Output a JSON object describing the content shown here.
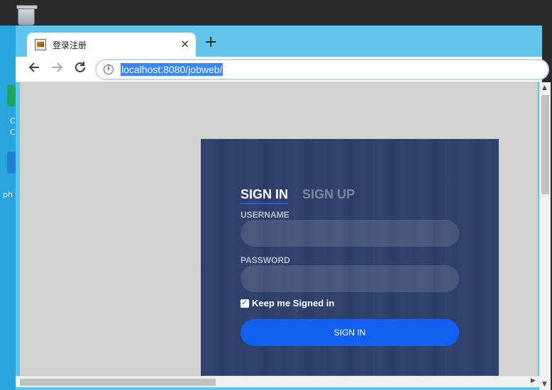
{
  "browser": {
    "tab_title": "登录注册",
    "tab_close": "×",
    "new_tab": "+",
    "url": "localhost:8080/jobweb/",
    "info_symbol": "i"
  },
  "desktop": {
    "icon_labels": [
      "C",
      "C",
      "ph"
    ]
  },
  "login": {
    "tab_signin": "SIGN IN",
    "tab_signup": "SIGN UP",
    "username_label": "USERNAME",
    "username_value": "",
    "password_label": "PASSWORD",
    "password_value": "",
    "keep_signed_in_label": "Keep me Signed in",
    "keep_signed_in_checked": true,
    "signin_button": "SIGN IN"
  },
  "colors": {
    "accent": "#1161ee",
    "card_bg": "#283866",
    "browser_frame": "#61c5ea",
    "page_bg": "#d2d2d2"
  },
  "icons": [
    "recycle-bin-icon",
    "favicon-icon",
    "close-icon",
    "plus-icon",
    "back-arrow-icon",
    "forward-arrow-icon",
    "reload-icon",
    "info-icon",
    "checkbox-icon"
  ]
}
